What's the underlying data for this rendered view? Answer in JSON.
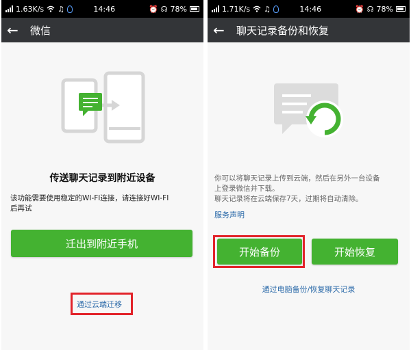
{
  "status_left": {
    "speed": "1.63K/s",
    "time": "14:46",
    "battery": "78%"
  },
  "status_right": {
    "speed": "1.71K/s",
    "time": "14:46",
    "battery": "78%"
  },
  "left": {
    "title": "微信",
    "heading": "传送聊天记录到附近设备",
    "description_line1": "该功能需要使用稳定的WI-FI连接，请连接好WI-FI",
    "description_line2": "后再试",
    "migrate_button": "迁出到附近手机",
    "cloud_link": "通过云端迁移"
  },
  "right": {
    "title": "聊天记录备份和恢复",
    "description_line1": "你可以将聊天记录上传到云端，然后在另外一台设备",
    "description_line2": "上登录微信并下载。",
    "description_line3": "聊天记录将在云端保存7天，过期将自动清除。",
    "service_link": "服务声明",
    "backup_button": "开始备份",
    "restore_button": "开始恢复",
    "pc_link": "通过电脑备份/恢复聊天记录"
  },
  "colors": {
    "green": "#44b231",
    "titlebar": "#333538",
    "highlight": "#e2232a",
    "link": "#2b6aa9",
    "illustration_gray": "#dcdcdc"
  },
  "icons": [
    "back-arrow-icon",
    "signal-icon",
    "wifi-icon",
    "music-icon",
    "qq-icon",
    "alarm-icon",
    "headset-icon",
    "battery-icon",
    "phone-transfer-illustration",
    "cloud-sync-illustration"
  ]
}
